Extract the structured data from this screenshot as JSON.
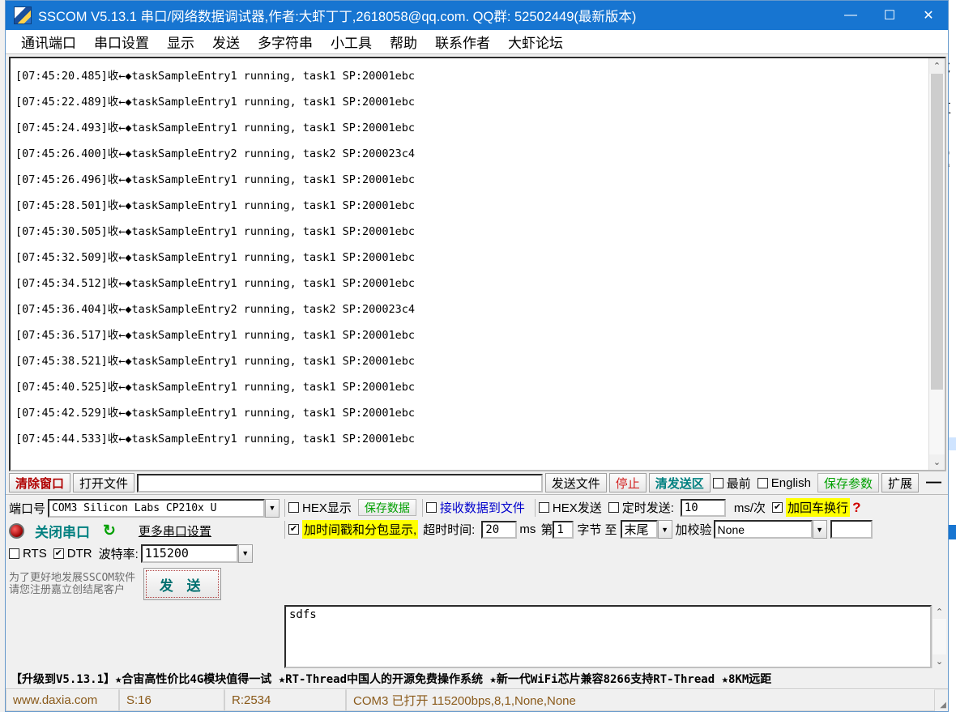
{
  "window": {
    "title": "SSCOM V5.13.1 串口/网络数据调试器,作者:大虾丁丁,2618058@qq.com. QQ群: 52502449(最新版本)",
    "minimize": "—",
    "maximize": "☐",
    "close": "✕"
  },
  "menu": {
    "items": [
      {
        "label": "通讯端口"
      },
      {
        "label": "串口设置"
      },
      {
        "label": "显示"
      },
      {
        "label": "发送"
      },
      {
        "label": "多字符串"
      },
      {
        "label": "小工具"
      },
      {
        "label": "帮助"
      },
      {
        "label": "联系作者"
      },
      {
        "label": "大虾论坛"
      }
    ]
  },
  "receive": {
    "lines": [
      "[07:45:20.485]收←◆taskSampleEntry1 running, task1 SP:20001ebc",
      "[07:45:22.489]收←◆taskSampleEntry1 running, task1 SP:20001ebc",
      "[07:45:24.493]收←◆taskSampleEntry1 running, task1 SP:20001ebc",
      "[07:45:26.400]收←◆taskSampleEntry2 running, task2 SP:200023c4",
      "[07:45:26.496]收←◆taskSampleEntry1 running, task1 SP:20001ebc",
      "[07:45:28.501]收←◆taskSampleEntry1 running, task1 SP:20001ebc",
      "[07:45:30.505]收←◆taskSampleEntry1 running, task1 SP:20001ebc",
      "[07:45:32.509]收←◆taskSampleEntry1 running, task1 SP:20001ebc",
      "[07:45:34.512]收←◆taskSampleEntry1 running, task1 SP:20001ebc",
      "[07:45:36.404]收←◆taskSampleEntry2 running, task2 SP:200023c4",
      "[07:45:36.517]收←◆taskSampleEntry1 running, task1 SP:20001ebc",
      "[07:45:38.521]收←◆taskSampleEntry1 running, task1 SP:20001ebc",
      "[07:45:40.525]收←◆taskSampleEntry1 running, task1 SP:20001ebc",
      "[07:45:42.529]收←◆taskSampleEntry1 running, task1 SP:20001ebc",
      "[07:45:44.533]收←◆taskSampleEntry1 running, task1 SP:20001ebc"
    ],
    "scroll_up_icon": "⌃",
    "scroll_down_icon": "⌄"
  },
  "toolbar": {
    "clear_window": "清除窗口",
    "open_file": "打开文件",
    "file_path_value": "",
    "send_file": "发送文件",
    "stop": "停止",
    "clear_send": "清发送区",
    "topmost_checked": false,
    "topmost_label": "最前",
    "english_checked": false,
    "english_label": "English",
    "save_params": "保存参数",
    "extend": "扩展",
    "collapse_icon": "—"
  },
  "port_settings": {
    "port_label": "端口号",
    "port_value": "COM3 Silicon Labs CP210x U",
    "close_port_button": "关闭串口",
    "refresh_icon": "↻",
    "more_settings_button": "更多串口设置",
    "rts_checked": false,
    "rts_label": "RTS",
    "dtr_checked": true,
    "dtr_label": "DTR",
    "baud_label": "波特率:",
    "baud_value": "115200",
    "promo_line1": "为了更好地发展SSCOM软件",
    "promo_line2": "请您注册嘉立创结尾客户",
    "send_button": "发 送"
  },
  "display_options": {
    "hex_display_checked": false,
    "hex_display_label": "HEX显示",
    "save_data_button": "保存数据",
    "recv_to_file_checked": false,
    "recv_to_file_label": "接收数据到文件",
    "timestamp_checked": true,
    "timestamp_label": "加时间戳和分包显示,",
    "timeout_label": "超时时间:",
    "timeout_value": "20",
    "timeout_unit": "ms"
  },
  "send_options": {
    "hex_send_checked": false,
    "hex_send_label": "HEX发送",
    "timed_send_checked": false,
    "timed_send_label": "定时发送:",
    "interval_value": "10",
    "interval_unit": "ms/次",
    "crlf_checked": true,
    "crlf_label": "加回车换行",
    "help_icon": "?",
    "byte_prefix": "第",
    "byte_start_value": "1",
    "byte_label": "字节 至",
    "byte_end_value": "末尾",
    "checksum_label": "加校验",
    "checksum_value": "None",
    "checksum_extra_value": ""
  },
  "send_text": {
    "value": "sdfs"
  },
  "ad_banner": {
    "text": "【升级到V5.13.1】★合宙高性价比4G模块值得一试 ★RT-Thread中国人的开源免费操作系统 ★新一代WiFi芯片兼容8266支持RT-Thread ★8KM远距"
  },
  "status_bar": {
    "url": "www.daxia.com",
    "sent": "S:16",
    "received": "R:2534",
    "port_status": "COM3 已打开  115200bps,8,1,None,None"
  },
  "colors": {
    "title_bar": "#1775d1",
    "highlight": "#ffff00",
    "clear_window_red": "#b00000",
    "stop_red": "#d22020",
    "clear_send_teal": "#008080",
    "save_params_green": "#00a000",
    "blue_label": "#0000cc",
    "status_text": "#8a5a1a"
  }
}
